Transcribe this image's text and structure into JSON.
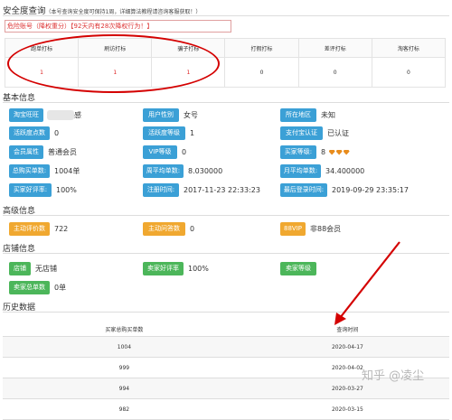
{
  "safety": {
    "title": "安全度查询",
    "note": "（本号查询安全度可保持1周，详细算法教程请咨询客服获取！）",
    "warning": "危险账号（降权重分）【92天内有28次降权行为！】",
    "metrics": [
      {
        "label": "跑单打标",
        "value": "1"
      },
      {
        "label": "刷访打标",
        "value": "1"
      },
      {
        "label": "骗子打标",
        "value": "1"
      },
      {
        "label": "打假打标",
        "value": "0"
      },
      {
        "label": "差评打标",
        "value": "0"
      },
      {
        "label": "淘客打标",
        "value": "0"
      }
    ]
  },
  "basic": {
    "title": "基本信息",
    "fields": [
      {
        "label": "淘宝旺旺",
        "value": "感",
        "color": "blue"
      },
      {
        "label": "用户性别",
        "value": "女号",
        "color": "blue"
      },
      {
        "label": "所在地区",
        "value": "未知",
        "color": "blue"
      },
      {
        "label": "活跃度点数",
        "value": "0",
        "color": "blue"
      },
      {
        "label": "活跃度等级",
        "value": "1",
        "color": "blue"
      },
      {
        "label": "支付宝认证",
        "value": "已认证",
        "color": "blue"
      },
      {
        "label": "会员属性",
        "value": "普通会员",
        "color": "blue"
      },
      {
        "label": "VIP等级",
        "value": "0",
        "color": "blue"
      },
      {
        "label": "买家等级:",
        "value": "8",
        "color": "blue"
      },
      {
        "label": "总购买单数:",
        "value": "1004单",
        "color": "blue"
      },
      {
        "label": "周平均单数:",
        "value": "8.030000",
        "color": "blue"
      },
      {
        "label": "月平均单数:",
        "value": "34.400000",
        "color": "blue"
      },
      {
        "label": "买家好评率:",
        "value": "100%",
        "color": "blue"
      },
      {
        "label": "注册时间:",
        "value": "2017-11-23 22:33:23",
        "color": "blue"
      },
      {
        "label": "最后登录时间:",
        "value": "2019-09-29 23:35:17",
        "color": "blue"
      }
    ]
  },
  "advanced": {
    "title": "高级信息",
    "fields": [
      {
        "label": "主动评价数",
        "value": "722",
        "color": "orange"
      },
      {
        "label": "主动问答数",
        "value": "0",
        "color": "orange"
      },
      {
        "label": "88VIP",
        "value": "非88会员",
        "color": "orange"
      }
    ]
  },
  "shop": {
    "title": "店铺信息",
    "fields": [
      {
        "label": "店铺",
        "value": "无店铺",
        "color": "green"
      },
      {
        "label": "卖家好评率",
        "value": "100%",
        "color": "green"
      },
      {
        "label": "卖家等级",
        "value": "",
        "color": "green"
      },
      {
        "label": "卖家总单数",
        "value": "0单",
        "color": "green"
      }
    ]
  },
  "history": {
    "title": "历史数据",
    "columns": [
      "买家总购买单数",
      "查询时间"
    ],
    "rows": [
      [
        "1004",
        "2020-04-17"
      ],
      [
        "999",
        "2020-04-02"
      ],
      [
        "994",
        "2020-03-27"
      ],
      [
        "982",
        "2020-03-15"
      ]
    ]
  },
  "watermark": "知乎 @凌尘",
  "colors": {
    "blue": "#3ba0d6",
    "orange": "#f0a830",
    "green": "#4cb65a",
    "annotation_red": "#d40000"
  }
}
